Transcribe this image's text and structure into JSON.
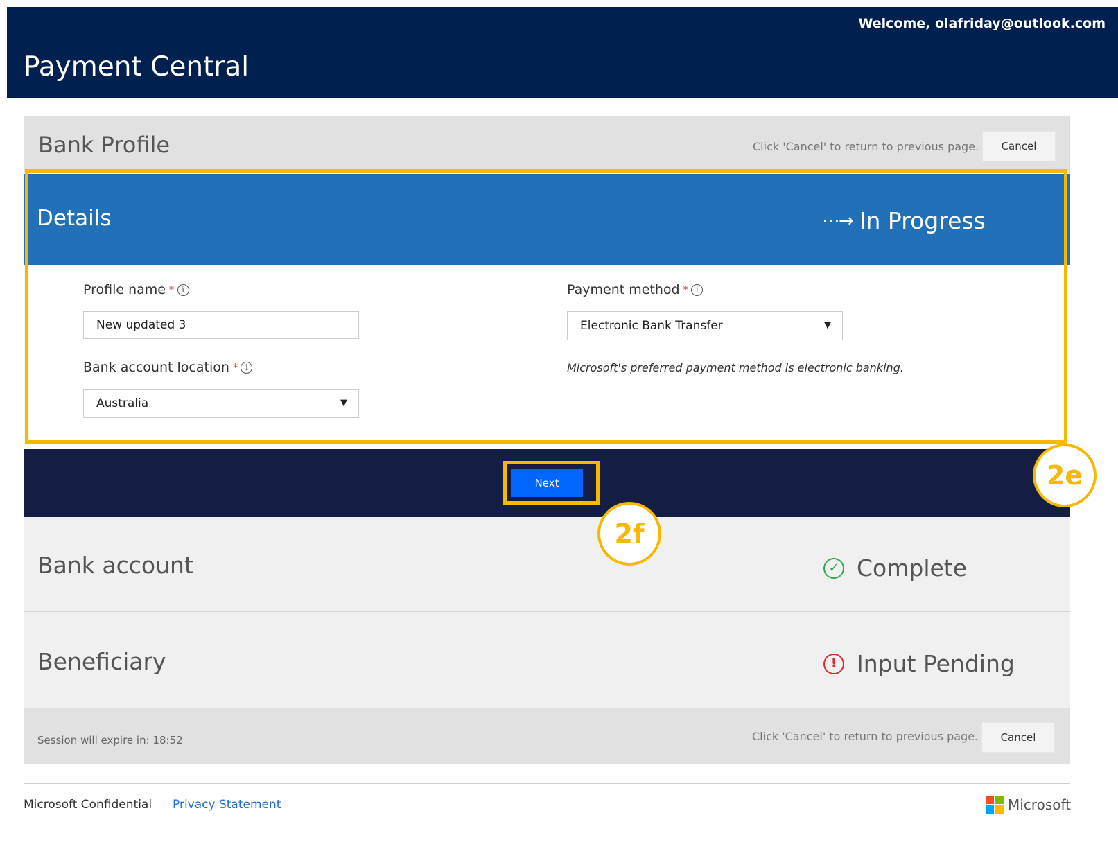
{
  "header": {
    "welcome": "Welcome, olafriday@outlook.com",
    "title": "Payment Central"
  },
  "bank_profile": {
    "title": "Bank Profile",
    "hint": "Click 'Cancel' to return to previous page.",
    "cancel_label": "Cancel"
  },
  "details": {
    "title": "Details",
    "status": "In Progress",
    "status_icon": "arrow-right-icon",
    "profile_name": {
      "label": "Profile name",
      "value": "New updated 3"
    },
    "bank_location": {
      "label": "Bank account location",
      "value": "Australia"
    },
    "payment_method": {
      "label": "Payment method",
      "value": "Electronic Bank Transfer"
    },
    "payment_note": "Microsoft's preferred payment method is electronic banking.",
    "required_mark": "*",
    "info_glyph": "i"
  },
  "next_label": "Next",
  "bank_account": {
    "title": "Bank account",
    "status": "Complete",
    "status_icon": "check-circle-icon",
    "color": "#37a85b"
  },
  "beneficiary": {
    "title": "Beneficiary",
    "status": "Input Pending",
    "status_icon": "alert-circle-icon",
    "color": "#d62d2d"
  },
  "footer_bar": {
    "session": "Session will expire in: 18:52",
    "hint": "Click 'Cancel' to return to previous page.",
    "cancel_label": "Cancel"
  },
  "page_footer": {
    "confidential": "Microsoft Confidential",
    "privacy": "Privacy Statement",
    "brand": "Microsoft"
  },
  "annotations": {
    "details_badge": "2e",
    "next_badge": "2f"
  },
  "colors": {
    "header_bg": "#00204f",
    "details_header": "#2170b8",
    "nav_band": "#141e45",
    "next_button": "#0066ff",
    "highlight": "#f7b800",
    "link": "#1f6fd1"
  }
}
